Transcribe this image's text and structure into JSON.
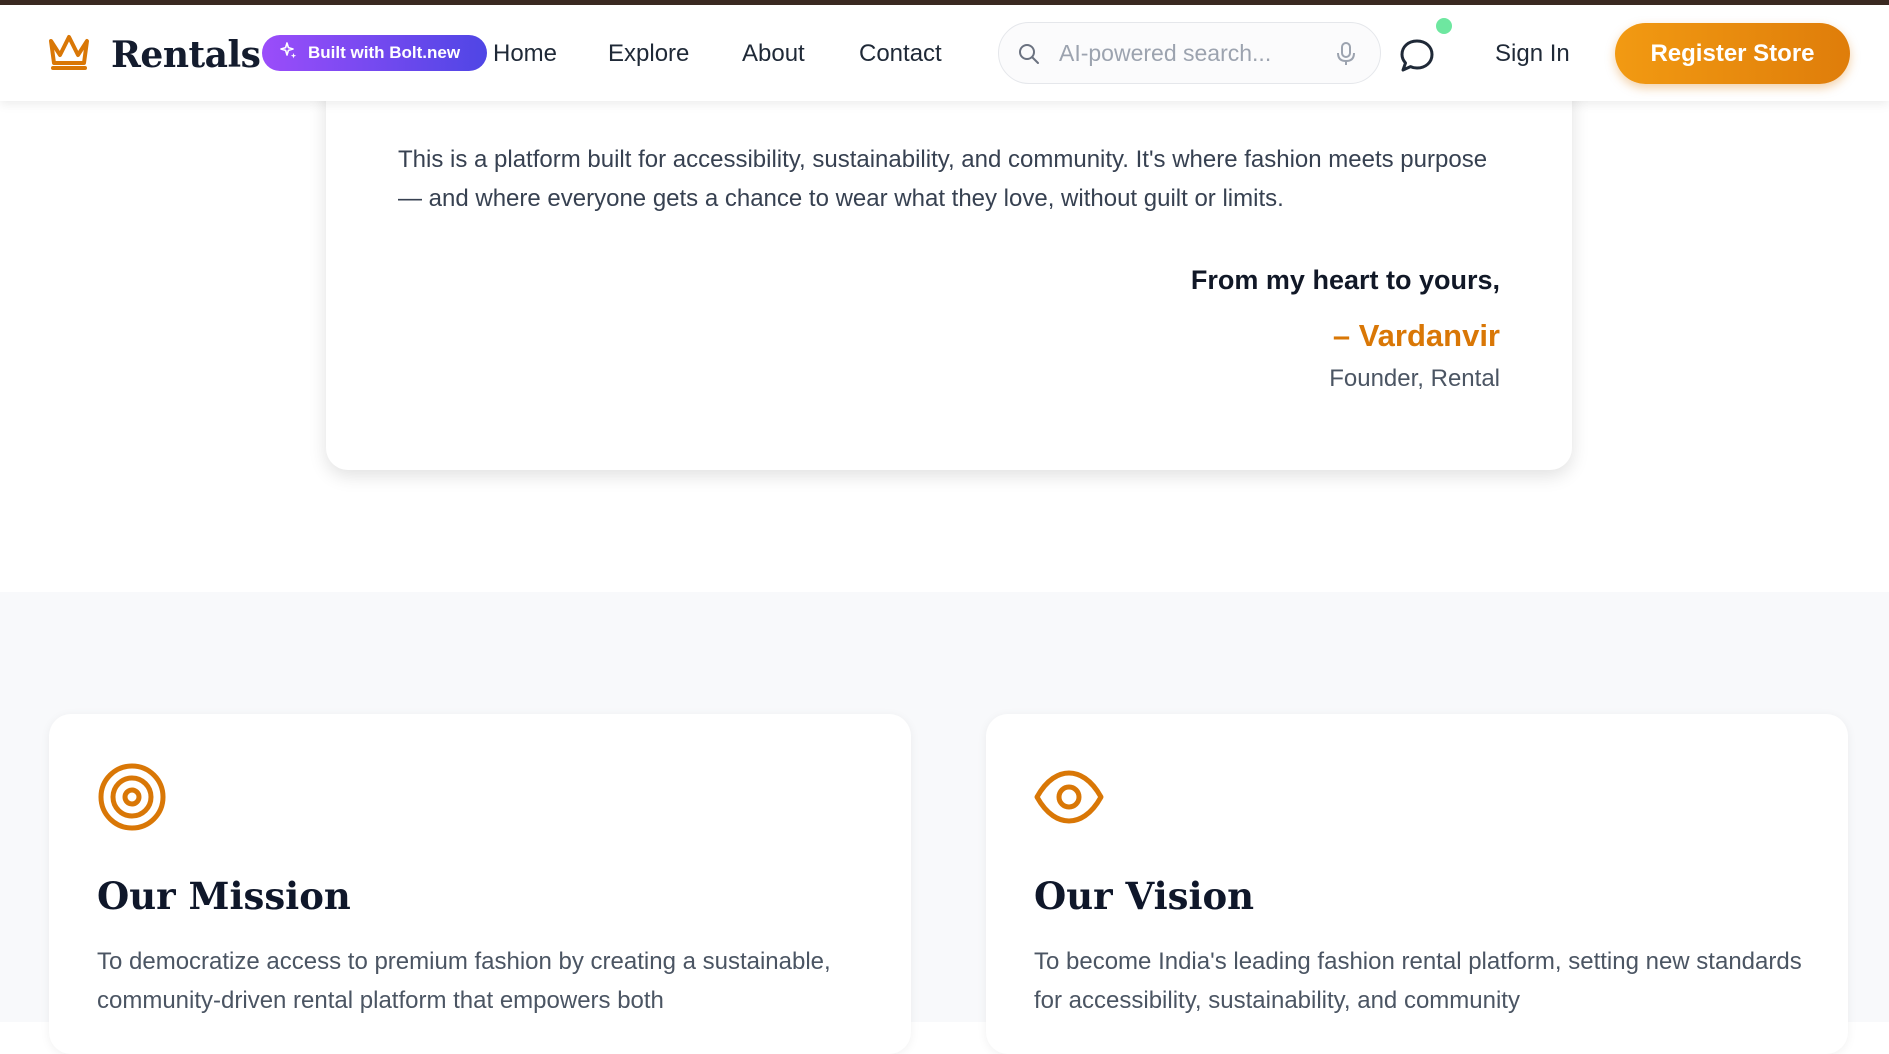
{
  "brand": {
    "name": "Rentals",
    "logo_icon": "crown-icon",
    "accent": "#d97706"
  },
  "badge": {
    "label": "Built with Bolt.new",
    "icon": "sparkle-icon"
  },
  "nav": {
    "items": [
      {
        "label": "Home"
      },
      {
        "label": "Explore"
      },
      {
        "label": "About"
      },
      {
        "label": "Contact"
      }
    ]
  },
  "search": {
    "placeholder": "AI-powered search...",
    "value": "",
    "icon": "search-icon",
    "voice_icon": "microphone-icon"
  },
  "chat": {
    "icon": "chat-bubble-icon",
    "status_color": "#6ee7a0"
  },
  "auth": {
    "sign_in": "Sign In",
    "register": "Register Store"
  },
  "letter": {
    "body": "This is a platform built for accessibility, sustainability, and community. It's where fashion meets purpose — and where everyone gets a chance to wear what they love, without guilt or limits.",
    "closing": "From my heart to yours,",
    "signer": "– Vardanvir",
    "role": "Founder, Rental"
  },
  "values": [
    {
      "icon": "target-icon",
      "title": "Our Mission",
      "description": "To democratize access to premium fashion by creating a sustainable, community-driven rental platform that empowers both"
    },
    {
      "icon": "eye-icon",
      "title": "Our Vision",
      "description": "To become India's leading fashion rental platform, setting new standards for accessibility, sustainability, and community"
    }
  ]
}
